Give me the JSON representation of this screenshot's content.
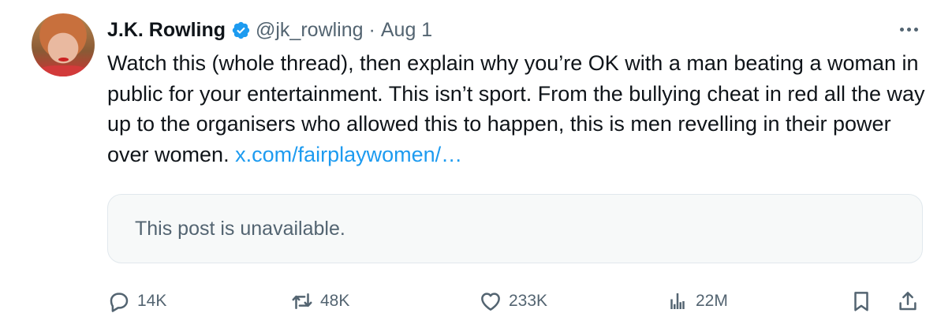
{
  "author": {
    "name": "J.K. Rowling",
    "handle": "@jk_rowling",
    "separator": "·",
    "date": "Aug 1"
  },
  "post": {
    "text": "Watch this (whole thread), then explain why you’re OK with a man beating a woman in public for your entertainment. This isn’t sport. From the bullying cheat in red all the way up to the organisers who allowed this to happen, this is men revelling in their power over women. ",
    "link_text": "x.com/fairplaywomen/…"
  },
  "quoted": {
    "unavailable_text": "This post is unavailable."
  },
  "actions": {
    "replies": "14K",
    "reposts": "48K",
    "likes": "233K",
    "views": "22M"
  },
  "icons": {
    "verified": "verified-badge-icon",
    "more": "more-options-icon",
    "reply": "reply-icon",
    "repost": "repost-icon",
    "like": "heart-icon",
    "views": "views-chart-icon",
    "bookmark": "bookmark-icon",
    "share": "share-icon"
  },
  "colors": {
    "text": "#0f1419",
    "secondary": "#536471",
    "link": "#1d9bf0",
    "verified": "#1d9bf0",
    "card_background": "#f7f9f9"
  }
}
